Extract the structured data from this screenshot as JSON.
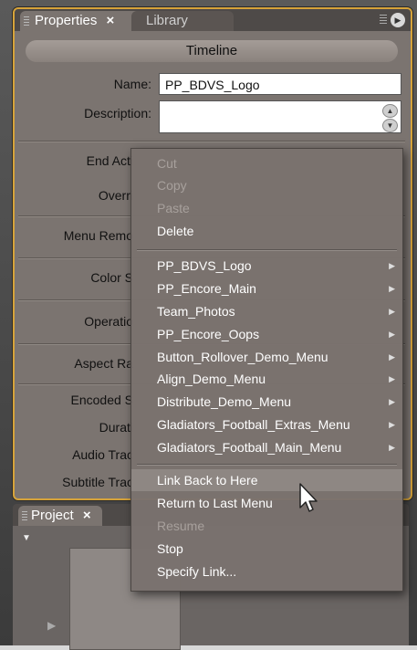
{
  "properties_panel": {
    "tabs": [
      {
        "label": "Properties",
        "close": "×"
      },
      {
        "label": "Library"
      }
    ],
    "header": "Timeline",
    "name_label": "Name:",
    "name_value": "PP_BDVS_Logo",
    "description_label": "Description:",
    "description_value": "",
    "fields": [
      {
        "label": "End Acti"
      },
      {
        "label": "Overri"
      },
      {
        "label": "Menu Remo"
      },
      {
        "label": "Color S"
      },
      {
        "label": "Operatio"
      },
      {
        "label": "Aspect Ra"
      },
      {
        "label": "Encoded S"
      },
      {
        "label": "Durati"
      },
      {
        "label": "Audio Trac"
      },
      {
        "label": "Subtitle Trac"
      }
    ]
  },
  "project_panel": {
    "tab_label": "Project",
    "close": "×"
  },
  "context_menu": {
    "edit_items": [
      {
        "label": "Cut",
        "enabled": false
      },
      {
        "label": "Copy",
        "enabled": false
      },
      {
        "label": "Paste",
        "enabled": false
      },
      {
        "label": "Delete",
        "enabled": true
      }
    ],
    "submenu_items": [
      {
        "label": "PP_BDVS_Logo"
      },
      {
        "label": "PP_Encore_Main"
      },
      {
        "label": "Team_Photos"
      },
      {
        "label": "PP_Encore_Oops"
      },
      {
        "label": "Button_Rollover_Demo_Menu"
      },
      {
        "label": "Align_Demo_Menu"
      },
      {
        "label": "Distribute_Demo_Menu"
      },
      {
        "label": "Gladiators_Football_Extras_Menu"
      },
      {
        "label": "Gladiators_Football_Main_Menu"
      }
    ],
    "link_items": [
      {
        "label": "Link Back to Here",
        "enabled": true,
        "highlighted": true
      },
      {
        "label": "Return to Last Menu",
        "enabled": true
      },
      {
        "label": "Resume",
        "enabled": false
      },
      {
        "label": "Stop",
        "enabled": true
      },
      {
        "label": "Specify Link...",
        "enabled": true
      }
    ]
  },
  "colors": {
    "panel_border": "#d6a33a",
    "panel_bg": "#7b7470",
    "menu_bg": "#7a726e"
  }
}
